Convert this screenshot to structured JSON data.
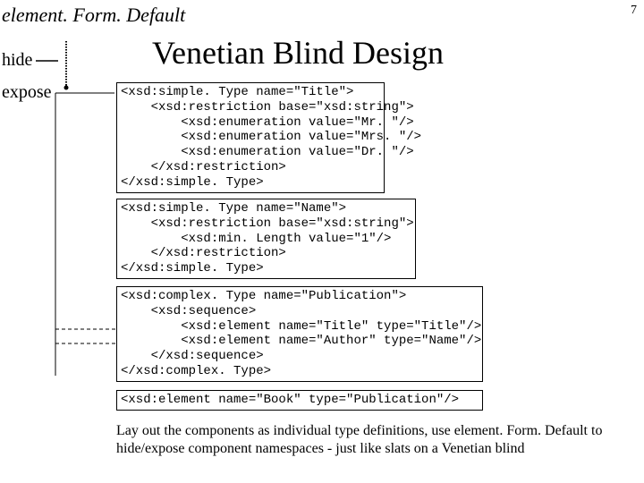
{
  "header_label": "element. Form. Default",
  "page_number": "7",
  "title": "Venetian Blind Design",
  "hide_label": "hide",
  "expose_label": "expose",
  "code_box_1": "<xsd:simple. Type name=\"Title\">\n    <xsd:restriction base=\"xsd:string\">\n        <xsd:enumeration value=\"Mr. \"/>\n        <xsd:enumeration value=\"Mrs. \"/>\n        <xsd:enumeration value=\"Dr. \"/>\n    </xsd:restriction>\n</xsd:simple. Type>",
  "code_box_2": "<xsd:simple. Type name=\"Name\">\n    <xsd:restriction base=\"xsd:string\">\n        <xsd:min. Length value=\"1\"/>\n    </xsd:restriction>\n</xsd:simple. Type>",
  "code_box_3": "<xsd:complex. Type name=\"Publication\">\n    <xsd:sequence>\n        <xsd:element name=\"Title\" type=\"Title\"/>\n        <xsd:element name=\"Author\" type=\"Name\"/>\n    </xsd:sequence>\n</xsd:complex. Type>",
  "code_box_4": "<xsd:element name=\"Book\" type=\"Publication\"/>",
  "caption": "Lay out the components as individual type definitions, use element. Form. Default to hide/expose component namespaces - just like slats on a Venetian blind"
}
